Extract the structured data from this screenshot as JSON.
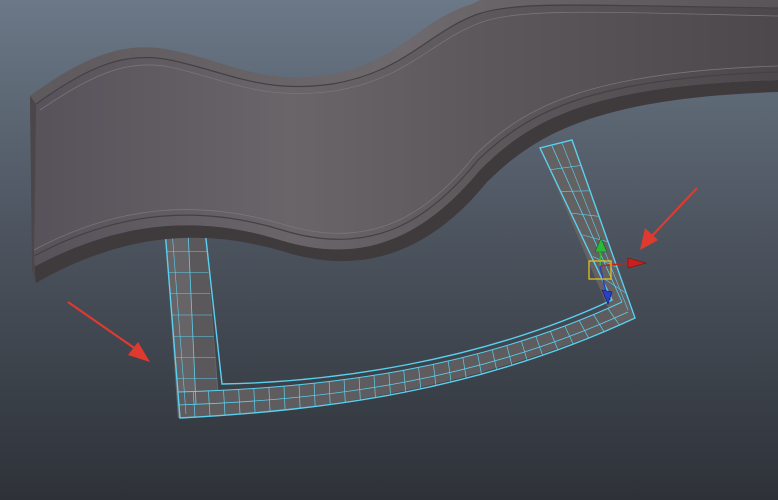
{
  "viewport": {
    "background_top": "#6b7887",
    "background_bottom": "#2e3238"
  },
  "colors": {
    "surface_face": "#5a5558",
    "surface_top": "#6b6669",
    "surface_edge": "#3f3b3d",
    "wire_selected": "#5ad0ee",
    "wire_face": "#6d6a6c",
    "wire_inner": "#3c3a3c",
    "annotation_arrow": "#e03a30",
    "manipulator_x": "#c8201c",
    "manipulator_y": "#2db83c",
    "manipulator_z": "#2a3fc8",
    "manipulator_center": "#e0c020"
  },
  "icons": {
    "arrow_left": "annotation-arrow",
    "arrow_right": "annotation-arrow",
    "manipulator": "move-tool-manipulator"
  }
}
